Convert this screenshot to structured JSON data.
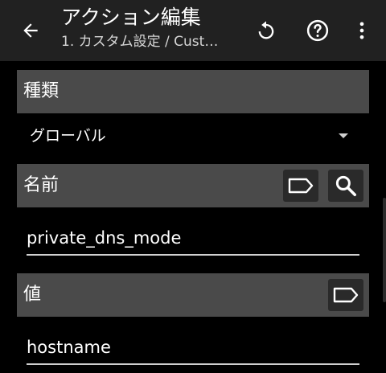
{
  "appbar": {
    "title": "アクション編集",
    "subtitle": "1. カスタム設定 / Cust…",
    "back_icon": "arrow-back-icon",
    "reset_icon": "reset-icon",
    "help_icon": "help-icon",
    "more_icon": "more-vert-icon"
  },
  "sections": {
    "type": {
      "label": "種類",
      "value": "グローバル"
    },
    "name": {
      "label": "名前",
      "value": "private_dns_mode",
      "tag_icon": "tag-icon",
      "search_icon": "search-icon"
    },
    "value": {
      "label": "値",
      "value": "hostname",
      "tag_icon": "tag-icon"
    }
  },
  "colors": {
    "appbar": "#212121",
    "section_header": "#4a4a4a",
    "background": "#000000"
  }
}
